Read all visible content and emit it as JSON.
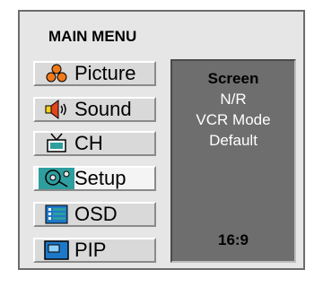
{
  "menu": {
    "title": "MAIN MENU",
    "items": [
      {
        "label": "Picture",
        "icon": "picture-icon",
        "selected": false
      },
      {
        "label": "Sound",
        "icon": "speaker-icon",
        "selected": false
      },
      {
        "label": "CH",
        "icon": "tv-antenna-icon",
        "selected": false
      },
      {
        "label": "Setup",
        "icon": "setup-icon",
        "selected": true
      },
      {
        "label": "OSD",
        "icon": "osd-icon",
        "selected": false
      },
      {
        "label": "PIP",
        "icon": "pip-icon",
        "selected": false
      }
    ]
  },
  "submenu": {
    "heading": "Screen",
    "options": [
      "N/R",
      "VCR Mode",
      "Default"
    ],
    "aspect_ratio": "16:9"
  },
  "colors": {
    "selected_icon_bg": "#2e9e9e",
    "submenu_bg": "#6e6e6e",
    "frame_bg": "#e6e6e6"
  }
}
